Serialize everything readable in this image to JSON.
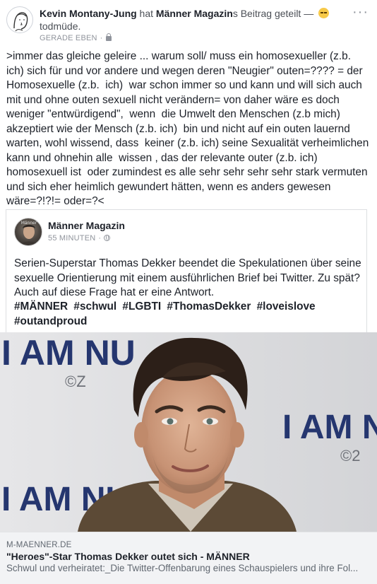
{
  "post": {
    "author": "Kevin Montany-Jung",
    "shared_word": " hat ",
    "shared_page": "Männer Magazin",
    "shared_suffix": "s Beitrag geteilt — ",
    "mood": "todmüde.",
    "mood_icon": "sleepy-face-emoji",
    "timestamp": "GERADE EBEN",
    "privacy_icon": "lock-icon",
    "more_label": "···",
    "text": ">immer das gleiche geleire ... warum soll/ muss ein homosexueller (z.b. ich) sich für und vor andere und wegen deren \"Neugier\" outen=???? = der Homosexuelle (z.b.  ich)  war schon immer so und kann und will sich auch mit und ohne outen sexuell nicht verändern= von daher wäre es doch weniger \"entwürdigend\",  wenn  die Umwelt den Menschen (z.b mich)  akzeptiert wie der Mensch (z.b. ich)  bin und nicht auf ein outen lauernd warten, wohl wissend, dass  keiner (z.b. ich) seine Sexualität verheimlichen kann und ohnehin alle  wissen , das der relevante outer (z.b. ich) homosexuell ist  oder zumindest es alle sehr sehr sehr sehr stark vermuten und sich eher heimlich gewundert hätten, wenn es anders gewesen wäre=?!?!= oder=?<"
  },
  "shared": {
    "page_name": "Männer Magazin",
    "avatar_text": "Männer",
    "time": "55 MINUTEN",
    "privacy_icon": "globe-icon",
    "text": "Serien-Superstar Thomas Dekker beendet die Spekulationen über seine sexuelle Orientierung mit einem ausführlichen Brief bei Twitter. Zu spät? Auch auf diese Frage hat er eine Antwort.",
    "hashtags": [
      "#MÄNNER",
      "#schwul",
      "#LGBTI",
      "#ThomasDekker",
      "#loveislove",
      "#outandproud"
    ]
  },
  "link": {
    "backdrop_text_1": "I AM NU",
    "backdrop_text_2": "I AM NUI",
    "backdrop_text_3": "I AM NU",
    "backdrop_small_1": "©Z",
    "backdrop_small_2": "©2",
    "domain": "M-MAENNER.DE",
    "title": "\"Heroes\"-Star Thomas Dekker outet sich - MÄNNER",
    "description": "Schwul und verheiratet:_Die Twitter-Offenbarung eines Schauspielers und ihre Fol..."
  },
  "colors": {
    "meta_grey": "#90949c",
    "card_border": "#dddfe2",
    "caption_bg": "#f2f3f5",
    "backdrop_blue": "#2a3a7a"
  }
}
